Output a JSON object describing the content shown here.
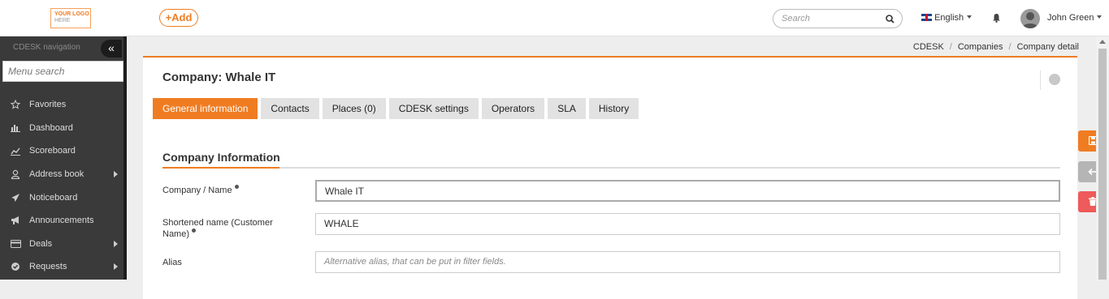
{
  "header": {
    "logo_line1": "YOUR LOGO",
    "logo_line2": "HERE",
    "add_label": "+Add",
    "search_placeholder": "Search",
    "language": "English",
    "user_name": "John Green"
  },
  "sidebar": {
    "title": "CDESK navigation",
    "collapse_icon": "«",
    "menu_search_placeholder": "Menu search",
    "items": [
      {
        "label": "Favorites",
        "icon": "star-icon",
        "has_children": false
      },
      {
        "label": "Dashboard",
        "icon": "bar-chart-icon",
        "has_children": false
      },
      {
        "label": "Scoreboard",
        "icon": "line-chart-icon",
        "has_children": false
      },
      {
        "label": "Address book",
        "icon": "user-icon",
        "has_children": true
      },
      {
        "label": "Noticeboard",
        "icon": "paper-plane-icon",
        "has_children": false
      },
      {
        "label": "Announcements",
        "icon": "megaphone-icon",
        "has_children": false
      },
      {
        "label": "Deals",
        "icon": "card-icon",
        "has_children": true
      },
      {
        "label": "Requests",
        "icon": "check-circle-icon",
        "has_children": true
      }
    ]
  },
  "breadcrumb": [
    "CDESK",
    "Companies",
    "Company detail"
  ],
  "page": {
    "title": "Company: Whale IT",
    "tabs": [
      {
        "label": "General information",
        "active": true
      },
      {
        "label": "Contacts",
        "active": false
      },
      {
        "label": "Places (0)",
        "active": false
      },
      {
        "label": "CDESK settings",
        "active": false
      },
      {
        "label": "Operators",
        "active": false
      },
      {
        "label": "SLA",
        "active": false
      },
      {
        "label": "History",
        "active": false
      }
    ],
    "section_title": "Company Information",
    "fields": [
      {
        "label": "Company / Name",
        "value": "Whale IT",
        "placeholder": "",
        "required": true
      },
      {
        "label": "Shortened name (Customer Name)",
        "value": "WHALE",
        "placeholder": "",
        "required": true
      },
      {
        "label": "Alias",
        "value": "",
        "placeholder": "Alternative alias, that can be put in filter fields.",
        "required": false
      }
    ]
  },
  "colors": {
    "accent": "#f07c22",
    "save": "#f07c22",
    "back": "#b5b5b5",
    "delete": "#ef5a5a",
    "sidebar_bg": "#3a3a3a"
  },
  "side_actions": {
    "save_icon": "floppy-icon",
    "back_icon": "arrow-left-icon",
    "delete_icon": "trash-icon"
  }
}
